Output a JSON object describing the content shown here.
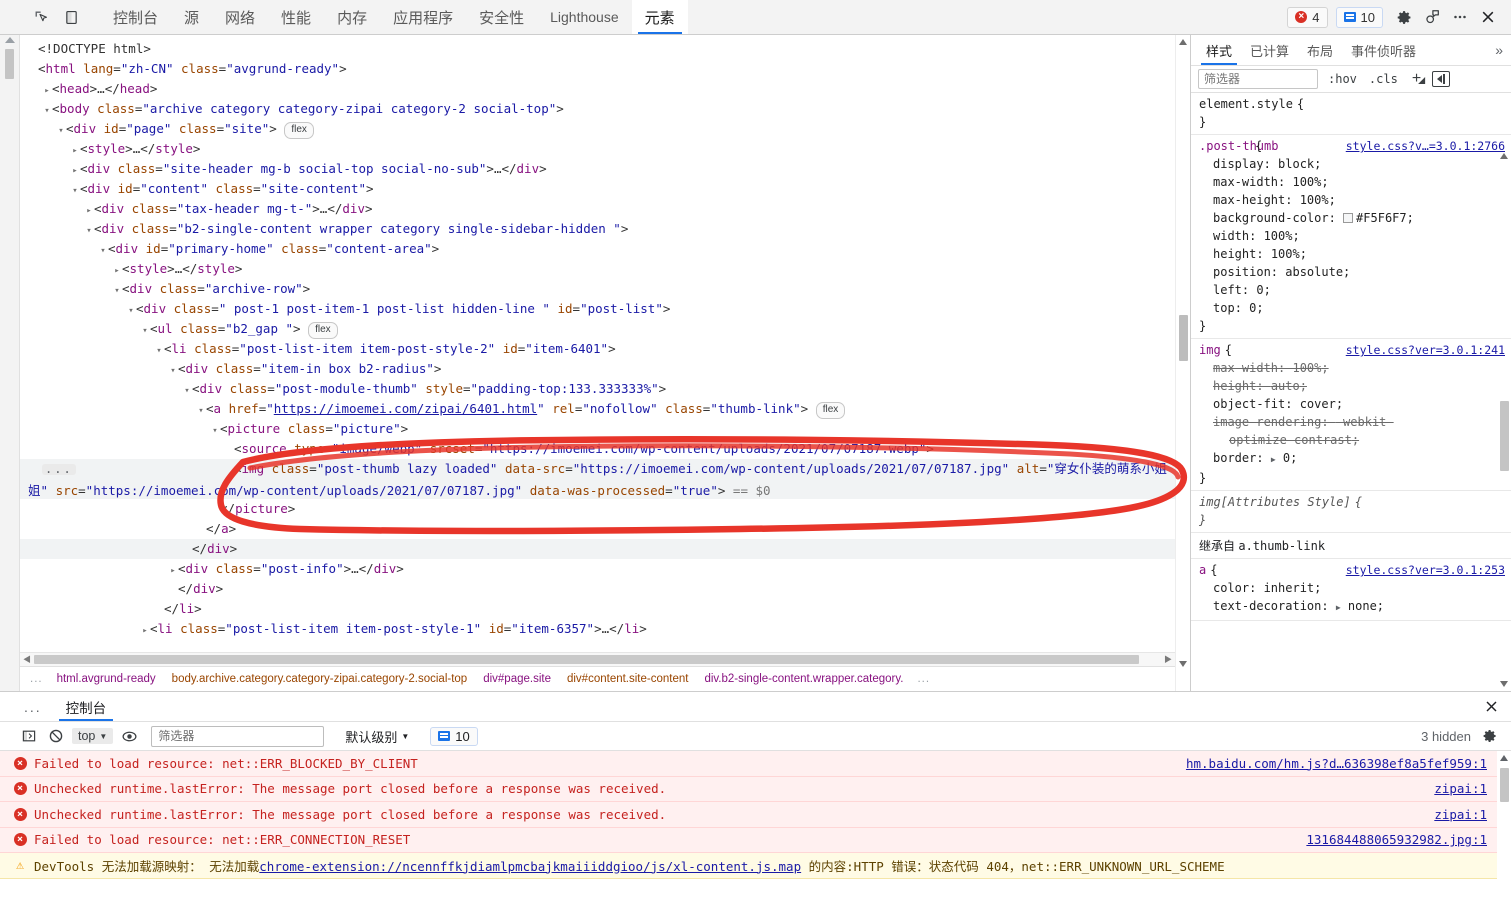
{
  "topbar": {
    "icons": [
      {
        "name": "inspect-element-icon",
        "label": "检查元素"
      },
      {
        "name": "device-toolbar-icon",
        "label": "设备工具栏"
      }
    ],
    "tabs": [
      {
        "label": "控制台",
        "active": false
      },
      {
        "label": "源",
        "active": false
      },
      {
        "label": "网络",
        "active": false
      },
      {
        "label": "性能",
        "active": false
      },
      {
        "label": "内存",
        "active": false
      },
      {
        "label": "应用程序",
        "active": false
      },
      {
        "label": "安全性",
        "active": false
      },
      {
        "label": "Lighthouse",
        "active": false
      },
      {
        "label": "元素",
        "active": true
      }
    ],
    "error_count": "4",
    "message_count": "10",
    "right_icons": [
      "gear-icon",
      "feedback-icon",
      "more-options-icon",
      "close-icon"
    ]
  },
  "dom": {
    "lines": [
      {
        "id": "l0",
        "indent": 0,
        "tri": "none"
      },
      {
        "id": "l1",
        "indent": 1,
        "tri": "none"
      },
      {
        "id": "l2",
        "indent": 1,
        "tri": "collapsed"
      },
      {
        "id": "l3",
        "indent": 1,
        "tri": "expanded"
      },
      {
        "id": "l4",
        "indent": 2,
        "tri": "expanded"
      }
    ],
    "doctype": "<!DOCTYPE html>",
    "html_open": {
      "tag": "html",
      "attrs": [
        [
          "lang",
          "zh-CN"
        ],
        [
          "class",
          "avgrund-ready"
        ]
      ]
    },
    "head_line": "<head>…</head>",
    "body_open": {
      "tag": "body",
      "attrs": [
        [
          "class",
          "archive category category-zipai category-2 social-top"
        ]
      ]
    },
    "page_div": {
      "tag": "div",
      "attrs": [
        [
          "id",
          "page"
        ],
        [
          "class",
          "site"
        ]
      ],
      "badge": "flex"
    },
    "style_line": "<style>…</style>",
    "site_header": {
      "tag": "div",
      "attrs": [
        [
          "class",
          "site-header mg-b social-top social-no-sub"
        ]
      ],
      "collapsed": "…</div>"
    },
    "content_div": {
      "tag": "div",
      "attrs": [
        [
          "id",
          "content"
        ],
        [
          "class",
          "site-content"
        ]
      ]
    },
    "tax_header": {
      "tag": "div",
      "attrs": [
        [
          "class",
          "tax-header mg-t-"
        ]
      ],
      "collapsed": "…</div>"
    },
    "b2_single": {
      "tag": "div",
      "attrs": [
        [
          "class",
          "b2-single-content wrapper category single-sidebar-hidden "
        ]
      ]
    },
    "primary_home": {
      "tag": "div",
      "attrs": [
        [
          "id",
          "primary-home"
        ],
        [
          "class",
          "content-area"
        ]
      ]
    },
    "style_line2": "<style>…</style>",
    "archive_row": {
      "tag": "div",
      "attrs": [
        [
          "class",
          "archive-row"
        ]
      ]
    },
    "post_list": {
      "tag": "div",
      "attrs": [
        [
          "class",
          " post-1 post-item-1 post-list hidden-line "
        ],
        [
          "id",
          "post-list"
        ]
      ]
    },
    "ul_b2gap": {
      "tag": "ul",
      "attrs": [
        [
          "class",
          "b2_gap "
        ]
      ],
      "badge": "flex"
    },
    "li_6401": {
      "tag": "li",
      "attrs": [
        [
          "class",
          "post-list-item item-post-style-2"
        ],
        [
          "id",
          "item-6401"
        ]
      ]
    },
    "item_in": {
      "tag": "div",
      "attrs": [
        [
          "class",
          "item-in box b2-radius"
        ]
      ]
    },
    "module_thumb": {
      "tag": "div",
      "attrs": [
        [
          "class",
          "post-module-thumb"
        ],
        [
          "style",
          "padding-top:133.333333%"
        ]
      ]
    },
    "a_thumb": {
      "tag": "a",
      "attrs": [
        [
          "href",
          "https://imoemei.com/zipai/6401.html"
        ],
        [
          "rel",
          "nofollow"
        ],
        [
          "class",
          "thumb-link"
        ]
      ],
      "badge": "flex"
    },
    "picture": {
      "tag": "picture",
      "attrs": [
        [
          "class",
          "picture"
        ]
      ]
    },
    "source": {
      "tag": "source",
      "attrs": [
        [
          "type",
          "image/webp"
        ],
        [
          "srcset",
          "https://imoemei.com/wp-content/uploads/2021/07/07187.webp"
        ]
      ]
    },
    "img_sel": {
      "tag": "img",
      "class_val": "post-thumb lazy loaded",
      "data_src": "https://imoemei.com/wp-content/uploads/2021/07/07187.jpg",
      "alt": "穿女仆装的萌系小姐姐",
      "src": "https://imoemei.com/wp-content/uploads/2021/07/07187.jpg",
      "data_was_processed": "true",
      "suffix": "== $0"
    },
    "close_picture": "</picture>",
    "close_a": "</a>",
    "close_div1": "</div>",
    "post_info": {
      "tag": "div",
      "attrs": [
        [
          "class",
          "post-info"
        ]
      ],
      "collapsed": "…</div>"
    },
    "close_div2": "</div>",
    "close_li": "</li>",
    "li_6357": {
      "tag": "li",
      "attrs": [
        [
          "class",
          "post-list-item item-post-style-1"
        ],
        [
          "id",
          "item-6357"
        ]
      ],
      "collapsed": "…</li>"
    },
    "ellipsis_badge": "..."
  },
  "breadcrumb": {
    "leading_dots": "...",
    "items": [
      "html.avgrund-ready",
      "body.archive.category.category-zipai.category-2.social-top",
      "div#page.site",
      "div#content.site-content",
      "div.b2-single-content.wrapper.category."
    ],
    "trailing_dots": "..."
  },
  "sidebar": {
    "tabs": [
      {
        "label": "样式",
        "active": true
      },
      {
        "label": "已计算",
        "active": false
      },
      {
        "label": "布局",
        "active": false
      },
      {
        "label": "事件侦听器",
        "active": false
      }
    ],
    "more_label": "»",
    "filter_placeholder": "筛选器",
    "hov_label": ":hov",
    "cls_label": ".cls",
    "plus_label": "+",
    "rules": [
      {
        "selector": "element.style",
        "source": "",
        "declarations": []
      },
      {
        "selector": ".post-thumb",
        "source": "style.css?v…=3.0.1:2766",
        "declarations": [
          {
            "prop": "display",
            "value": "block",
            "struck": false
          },
          {
            "prop": "max-width",
            "value": "100%",
            "struck": false
          },
          {
            "prop": "max-height",
            "value": "100%",
            "struck": false
          },
          {
            "prop": "background-color",
            "value": "#F5F6F7",
            "struck": false,
            "swatch": "#F5F6F7"
          },
          {
            "prop": "width",
            "value": "100%",
            "struck": false
          },
          {
            "prop": "height",
            "value": "100%",
            "struck": false
          },
          {
            "prop": "position",
            "value": "absolute",
            "struck": false
          },
          {
            "prop": "left",
            "value": "0",
            "struck": false
          },
          {
            "prop": "top",
            "value": "0",
            "struck": false
          }
        ]
      },
      {
        "selector": "img",
        "source": "style.css?ver=3.0.1:241",
        "declarations": [
          {
            "prop": "max-width",
            "value": "100%",
            "struck": true
          },
          {
            "prop": "height",
            "value": "auto",
            "struck": true
          },
          {
            "prop": "object-fit",
            "value": "cover",
            "struck": false
          },
          {
            "prop": "image-rendering",
            "value": "-webkit-",
            "struck": true,
            "cont": "optimize-contrast"
          },
          {
            "prop": "border",
            "value": "0",
            "struck": false,
            "expandable": true
          }
        ]
      },
      {
        "selector": "img[Attributes Style]",
        "source": "",
        "italic": true,
        "declarations": []
      }
    ],
    "inherited_label": "继承自",
    "inherited_from": "a.thumb-link",
    "inherited_rule": {
      "selector": "a",
      "source": "style.css?ver=3.0.1:253",
      "declarations": [
        {
          "prop": "color",
          "value": "inherit",
          "struck": false
        },
        {
          "prop": "text-decoration",
          "value": "none",
          "struck": false,
          "expandable": true
        }
      ]
    }
  },
  "drawer": {
    "dots": "...",
    "tabs": [
      {
        "label": "控制台",
        "active": true
      }
    ],
    "toolbar": {
      "sidebar_icon": "console-sidebar-icon",
      "clear_icon": "clear-console-icon",
      "context": "top",
      "eye_icon": "live-expression-icon",
      "filter_placeholder": "筛选器",
      "level": "默认级别",
      "message_count": "10",
      "hidden_label": "3 hidden",
      "settings_icon": "gear-icon"
    },
    "messages": [
      {
        "level": "error",
        "text": "Failed to load resource: net::ERR_BLOCKED_BY_CLIENT",
        "source": "hm.baidu.com/hm.js?d…636398ef8a5fef959:1"
      },
      {
        "level": "error",
        "text": "Unchecked runtime.lastError: The message port closed before a response was received.",
        "source": "zipai:1"
      },
      {
        "level": "error",
        "text": "Unchecked runtime.lastError: The message port closed before a response was received.",
        "source": "zipai:1"
      },
      {
        "level": "error",
        "text": "Failed to load resource: net::ERR_CONNECTION_RESET",
        "source": "131684488065932982.jpg:1"
      },
      {
        "level": "warning",
        "text_pre": "DevTools 无法加载源映射：  无法加载",
        "link": "chrome-extension://ncennffkjdiamlpmcbajkmaiiiddgioo/js/xl-content.js.map",
        "text_post": " 的内容:HTTP 错误：状态代码 404，net::ERR_UNKNOWN_URL_SCHEME",
        "source": ""
      }
    ]
  },
  "annotation": {
    "name": "red-highlight-circle",
    "color": "#e8352a",
    "description": "hand-drawn red ellipse around selected img element"
  },
  "colors": {
    "accent": "#1a73e8",
    "error": "#d93025",
    "tag": "#881280",
    "attr_name": "#994500",
    "attr_value": "#1a1aa6",
    "swatch": "#F5F6F7"
  }
}
